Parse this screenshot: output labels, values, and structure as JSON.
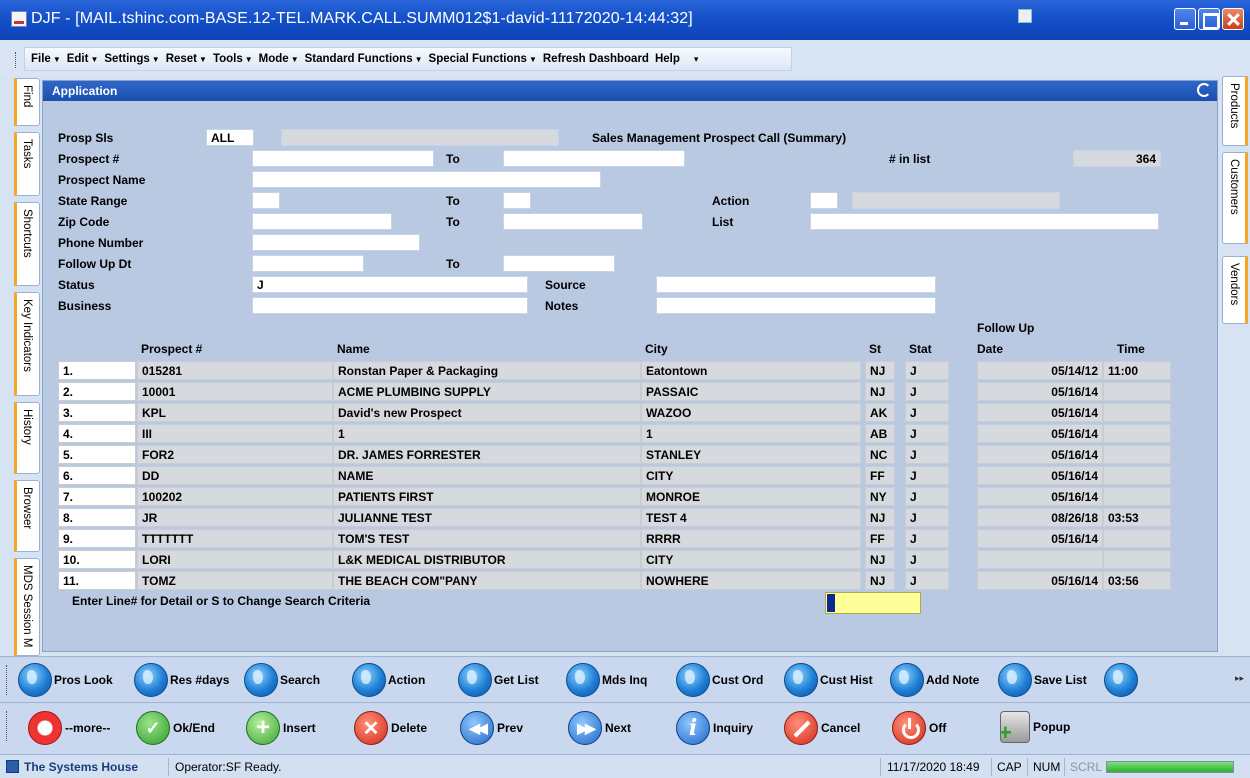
{
  "window": {
    "title": "DJF - [MAIL.tshinc.com-BASE.12-TEL.MARK.CALL.SUMM012$1-david-11172020-14:44:32]"
  },
  "menu": {
    "items": [
      {
        "label": "File",
        "has_arrow": true
      },
      {
        "label": "Edit",
        "has_arrow": true
      },
      {
        "label": "Settings",
        "has_arrow": true
      },
      {
        "label": "Reset",
        "has_arrow": true
      },
      {
        "label": "Tools",
        "has_arrow": true
      },
      {
        "label": "Mode",
        "has_arrow": true
      },
      {
        "label": "Standard Functions",
        "has_arrow": true
      },
      {
        "label": "Special Functions",
        "has_arrow": true
      },
      {
        "label": "Refresh Dashboard",
        "has_arrow": false
      },
      {
        "label": "Help",
        "has_arrow": false
      }
    ],
    "overflow_glyph": "▾"
  },
  "left_tabs": [
    "Find",
    "Tasks",
    "Shortcuts",
    "Key Indicators",
    "History",
    "Browser",
    "MDS Session M"
  ],
  "right_tabs": [
    "Products",
    "Customers",
    "Vendors"
  ],
  "panel": {
    "title": "Application",
    "heading": "Sales Management Prospect Call  (Summary)"
  },
  "form": {
    "prosp_sls": {
      "label": "Prosp Sls",
      "value": "ALL",
      "desc": ""
    },
    "prospect_no": {
      "label": "Prospect #",
      "from": "",
      "to_label": "To",
      "to": ""
    },
    "num_in_list": {
      "label": "# in list",
      "value": "364"
    },
    "prospect_name": {
      "label": "Prospect Name",
      "value": ""
    },
    "state_range": {
      "label": "State Range",
      "from": "",
      "to_label": "To",
      "to": ""
    },
    "action": {
      "label": "Action",
      "code": "",
      "desc": ""
    },
    "zip_code": {
      "label": "Zip Code",
      "from": "",
      "to_label": "To",
      "to": ""
    },
    "list": {
      "label": "List",
      "value": ""
    },
    "phone_number": {
      "label": "Phone Number",
      "value": ""
    },
    "follow_up_dt": {
      "label": "Follow Up Dt",
      "from": "",
      "to_label": "To",
      "to": ""
    },
    "status": {
      "label": "Status",
      "value": "J"
    },
    "source": {
      "label": "Source",
      "value": ""
    },
    "business": {
      "label": "Business",
      "value": ""
    },
    "notes": {
      "label": "Notes",
      "value": ""
    }
  },
  "table": {
    "headers": {
      "prospect": "Prospect #",
      "name": "Name",
      "city": "City",
      "st": "St",
      "stat": "Stat",
      "follow_up": "Follow Up",
      "date": "Date",
      "time": "Time"
    },
    "rows": [
      {
        "line": "1.",
        "prospect": "015281",
        "name": "Ronstan Paper & Packaging",
        "city": "Eatontown",
        "st": "NJ",
        "stat": "J",
        "date": "05/14/12",
        "time": "11:00"
      },
      {
        "line": "2.",
        "prospect": "10001",
        "name": "ACME PLUMBING SUPPLY",
        "city": "PASSAIC",
        "st": "NJ",
        "stat": "J",
        "date": "05/16/14",
        "time": ""
      },
      {
        "line": "3.",
        "prospect": "KPL",
        "name": "David's new Prospect",
        "city": "WAZOO",
        "st": "AK",
        "stat": "J",
        "date": "05/16/14",
        "time": ""
      },
      {
        "line": "4.",
        "prospect": "III",
        "name": "1",
        "city": "1",
        "st": "AB",
        "stat": "J",
        "date": "05/16/14",
        "time": ""
      },
      {
        "line": "5.",
        "prospect": "FOR2",
        "name": "DR. JAMES FORRESTER",
        "city": "STANLEY",
        "st": "NC",
        "stat": "J",
        "date": "05/16/14",
        "time": ""
      },
      {
        "line": "6.",
        "prospect": "DD",
        "name": "NAME",
        "city": "CITY",
        "st": "FF",
        "stat": "J",
        "date": "05/16/14",
        "time": ""
      },
      {
        "line": "7.",
        "prospect": "100202",
        "name": "PATIENTS FIRST",
        "city": "MONROE",
        "st": "NY",
        "stat": "J",
        "date": "05/16/14",
        "time": ""
      },
      {
        "line": "8.",
        "prospect": "JR",
        "name": "JULIANNE TEST",
        "city": "TEST 4",
        "st": "NJ",
        "stat": "J",
        "date": "08/26/18",
        "time": "03:53"
      },
      {
        "line": "9.",
        "prospect": "TTTTTTT",
        "name": "TOM'S TEST",
        "city": "RRRR",
        "st": "FF",
        "stat": "J",
        "date": "05/16/14",
        "time": ""
      },
      {
        "line": "10.",
        "prospect": "LORI",
        "name": "L&K MEDICAL DISTRIBUTOR",
        "city": "CITY",
        "st": "NJ",
        "stat": "J",
        "date": "",
        "time": ""
      },
      {
        "line": "11.",
        "prospect": "TOMZ",
        "name": "THE BEACH COM\"PANY",
        "city": "NOWHERE",
        "st": "NJ",
        "stat": "J",
        "date": "05/16/14",
        "time": "03:56"
      }
    ],
    "prompt": "Enter Line# for Detail or S to Change Search Criteria",
    "input_value": ""
  },
  "toolbar1": {
    "buttons": [
      {
        "name": "pros-look-button",
        "label": "Pros Look",
        "icon": "globe-icon"
      },
      {
        "name": "res-days-button",
        "label": "Res #days",
        "icon": "globe-icon"
      },
      {
        "name": "search-button",
        "label": "Search",
        "icon": "globe-icon"
      },
      {
        "name": "action-button",
        "label": "Action",
        "icon": "globe-icon"
      },
      {
        "name": "get-list-button",
        "label": "Get List",
        "icon": "globe-icon"
      },
      {
        "name": "mds-inq-button",
        "label": "Mds Inq",
        "icon": "globe-icon"
      },
      {
        "name": "cust-ord-button",
        "label": "Cust Ord",
        "icon": "globe-icon"
      },
      {
        "name": "cust-hist-button",
        "label": "Cust Hist",
        "icon": "globe-icon"
      },
      {
        "name": "add-note-button",
        "label": "Add Note",
        "icon": "globe-icon"
      },
      {
        "name": "save-list-button",
        "label": "Save List",
        "icon": "globe-icon"
      },
      {
        "name": "blank-button",
        "label": "",
        "icon": "globe-icon"
      }
    ]
  },
  "toolbar2": {
    "buttons": [
      {
        "label": "--more--",
        "icon": "lifebuoy-icon"
      },
      {
        "label": "Ok/End",
        "icon": "checkmark-icon"
      },
      {
        "label": "Insert",
        "icon": "plus-icon"
      },
      {
        "label": "Delete",
        "icon": "x-icon"
      },
      {
        "label": "Prev",
        "icon": "rewind-icon"
      },
      {
        "label": "Next",
        "icon": "fast-forward-icon"
      },
      {
        "label": "Inquiry",
        "icon": "info-icon"
      },
      {
        "label": "Cancel",
        "icon": "cancel-icon"
      },
      {
        "label": "Off",
        "icon": "power-icon"
      },
      {
        "label": "Popup",
        "icon": "database-add-icon"
      }
    ]
  },
  "status": {
    "company": "The Systems House",
    "operator": "Operator:SF Ready.",
    "datetime": "11/17/2020 18:49",
    "cap": "CAP",
    "num": "NUM",
    "scrl": "SCRL",
    "progress": 1.0
  },
  "colors": {
    "titlebar": "#1450c8",
    "panel_bg": "#b9c9e2",
    "field_gray": "#d6d9de",
    "cursor_field": "#ffff99",
    "tab_accent": "#f5a623"
  }
}
